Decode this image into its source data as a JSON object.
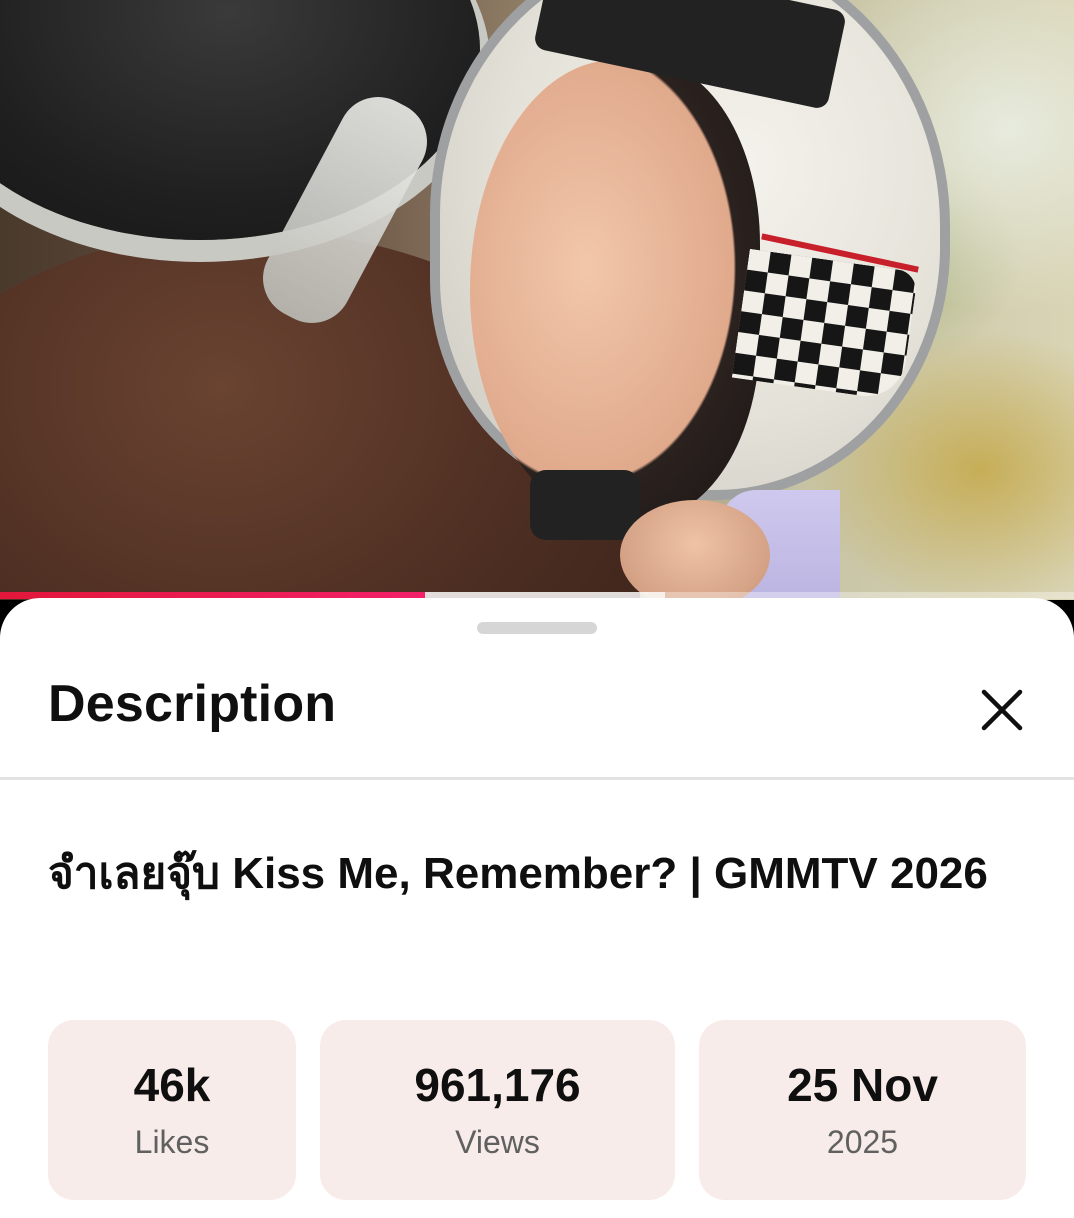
{
  "player": {
    "progress_played": 0.396,
    "progress_buffered": 0.619,
    "accent_color": "#f3206a"
  },
  "sheet": {
    "title": "Description",
    "close_icon": "close-icon"
  },
  "video": {
    "title": "จำเลยจุ๊บ Kiss Me, Remember? | GMMTV 2026"
  },
  "stats": [
    {
      "value": "46k",
      "label": "Likes"
    },
    {
      "value": "961,176",
      "label": "Views"
    },
    {
      "value": "25 Nov",
      "label": "2025"
    }
  ],
  "colors": {
    "stat_background": "#f7ece9",
    "text_primary": "#0f0f0f",
    "text_secondary": "#606060"
  }
}
